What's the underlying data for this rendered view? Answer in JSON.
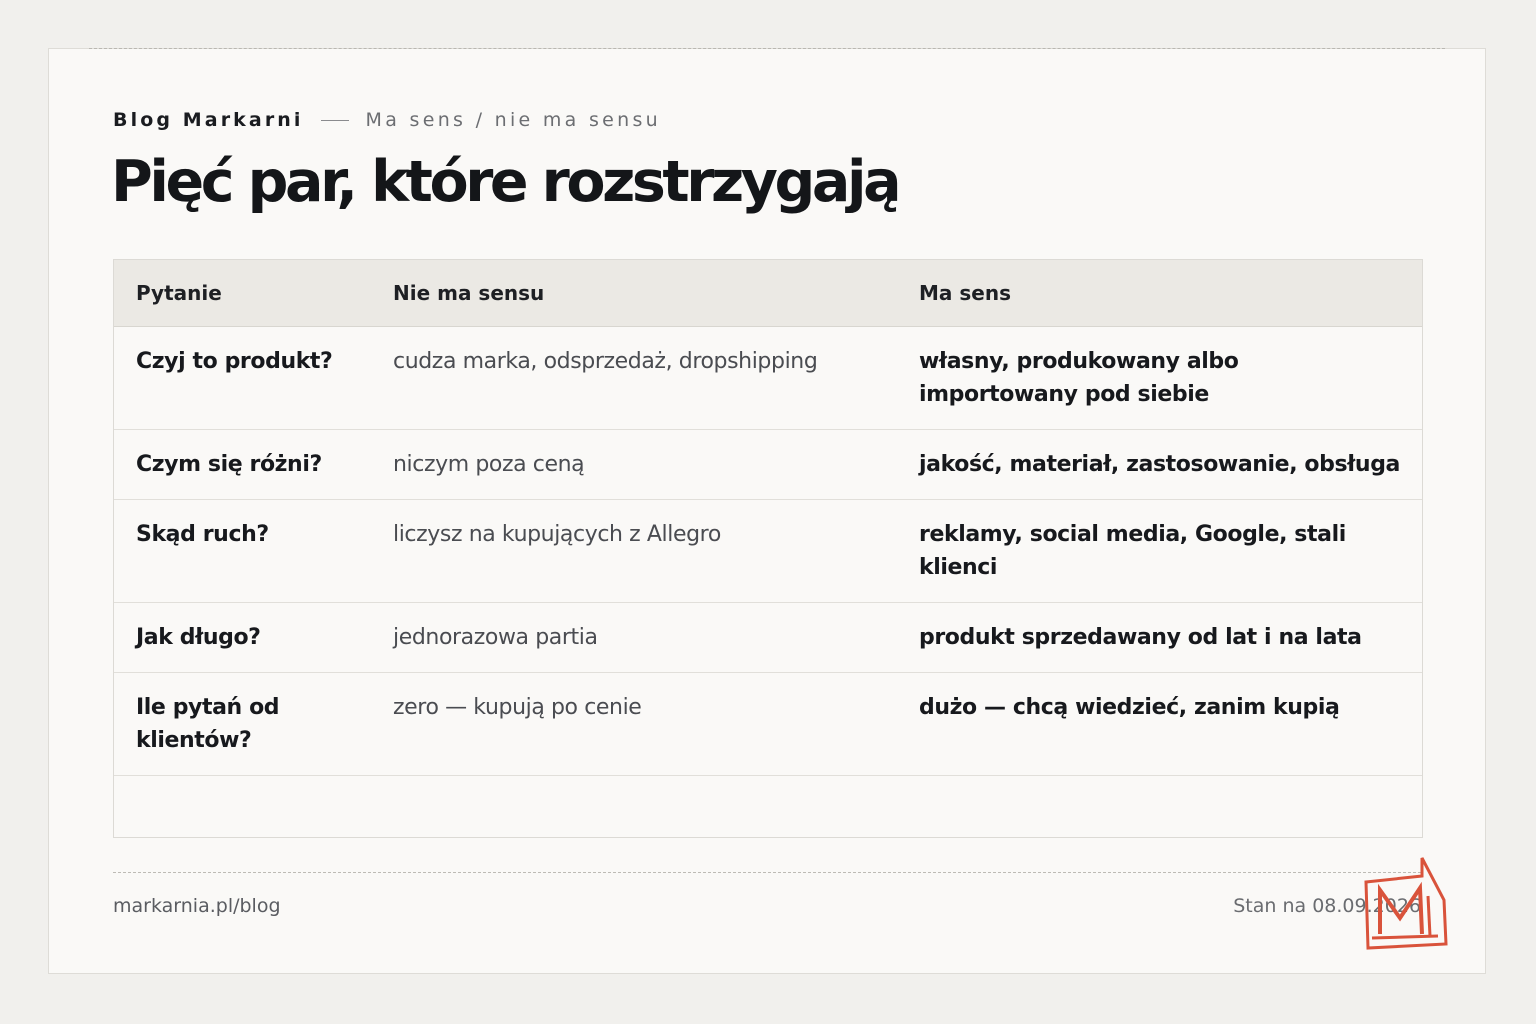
{
  "header": {
    "brand": "Blog Markarni",
    "section": "Ma sens / nie ma sensu",
    "title": "Pięć par, które rozstrzygają"
  },
  "table": {
    "columns": [
      "Pytanie",
      "Nie ma sensu",
      "Ma sens"
    ],
    "rows": [
      {
        "question": "Czyj to produkt?",
        "no": "cudza marka, odsprzedaż, dropshipping",
        "yes": "własny, produkowany albo importowany pod siebie"
      },
      {
        "question": "Czym się różni?",
        "no": "niczym poza ceną",
        "yes": "jakość, materiał, zastosowanie, obsługa"
      },
      {
        "question": "Skąd ruch?",
        "no": "liczysz na kupujących z Allegro",
        "yes": "reklamy, social media, Google, stali klienci"
      },
      {
        "question": "Jak długo?",
        "no": "jednorazowa partia",
        "yes": "produkt sprzedawany od lat i na lata"
      },
      {
        "question": "Ile pytań od klientów?",
        "no": "zero — kupują po cenie",
        "yes": "dużo — chcą wiedzieć, zanim kupią"
      }
    ]
  },
  "footer": {
    "url": "markarnia.pl/blog",
    "date": "Stan na 08.09.2026"
  },
  "logo": {
    "icon": "markarnia-m-logo",
    "color": "#d9533b"
  }
}
